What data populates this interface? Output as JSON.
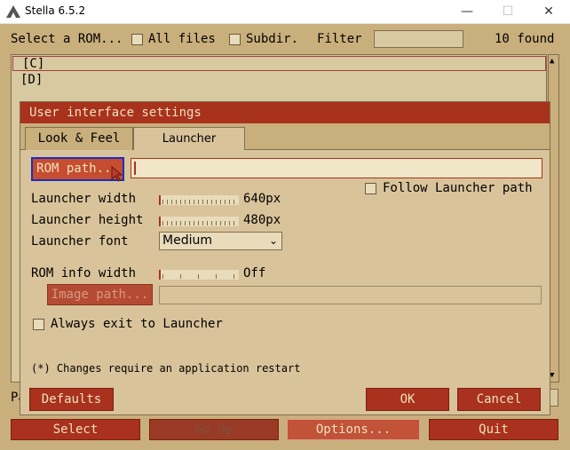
{
  "window": {
    "title": "Stella 6.5.2",
    "min_glyph": "—",
    "max_glyph": "☐",
    "close_glyph": "✕"
  },
  "launcher": {
    "header": {
      "select_label": "Select a ROM...",
      "all_files_label": "All files",
      "subdir_label": "Subdir.",
      "filter_label": "Filter",
      "found_label": "10 found"
    },
    "rom_list": [
      "[C]",
      "[D]"
    ],
    "scroll_up": "▲",
    "scroll_down": "▼",
    "path_label": "Path",
    "buttons": {
      "select": "Select",
      "go_up": "Go Up",
      "options": "Options...",
      "quit": "Quit"
    }
  },
  "dialog": {
    "title": "User interface settings",
    "tabs": [
      "Look & Feel",
      "Launcher"
    ],
    "rom_path_button": "ROM path...",
    "rom_path_value": "",
    "follow_launcher_path_label": "Follow Launcher path",
    "launcher_width_label": "Launcher width",
    "launcher_width_value": "640px",
    "launcher_height_label": "Launcher height",
    "launcher_height_value": "480px",
    "launcher_font_label": "Launcher font",
    "launcher_font_value": "Medium",
    "rom_info_width_label": "ROM info width",
    "rom_info_width_value": "Off",
    "image_path_button": "Image path...",
    "image_path_value": "",
    "always_exit_label": "Always exit to Launcher",
    "restart_note": "(*) Changes require an application restart",
    "buttons": {
      "defaults": "Defaults",
      "ok": "OK",
      "cancel": "Cancel"
    }
  },
  "colors": {
    "background": "#c9af7c",
    "panel": "#d9c39a",
    "accent": "#a8321c",
    "focus_border": "#1c2dbf"
  }
}
